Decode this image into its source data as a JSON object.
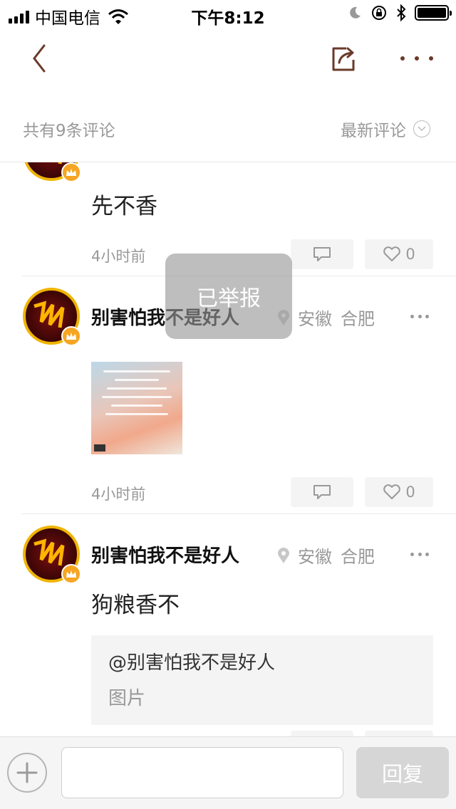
{
  "status_bar": {
    "carrier": "中国电信",
    "time": "下午8:12"
  },
  "nav": {
    "back_icon": "chevron-left-icon",
    "share_icon": "share-icon",
    "more_icon": "more-icon"
  },
  "comments": {
    "count_text": "共有9条评论",
    "sort_label": "最新评论"
  },
  "items": [
    {
      "content": "先不香",
      "time": "4小时前",
      "likes": "0"
    },
    {
      "username": "别害怕我不是好人",
      "province": "安徽",
      "city": "合肥",
      "time": "4小时前",
      "likes": "0"
    },
    {
      "username": "别害怕我不是好人",
      "province": "安徽",
      "city": "合肥",
      "content": "狗粮香不",
      "quote_user": "@别害怕我不是好人",
      "quote_text": "图片"
    }
  ],
  "toast": "已举报",
  "composer": {
    "add_icon": "plus-icon",
    "input_value": "",
    "send_label": "回复"
  },
  "colors": {
    "brand_brown": "#6b3a2a",
    "crown": "#f6a623",
    "avatar_ring": "#f0b400"
  }
}
